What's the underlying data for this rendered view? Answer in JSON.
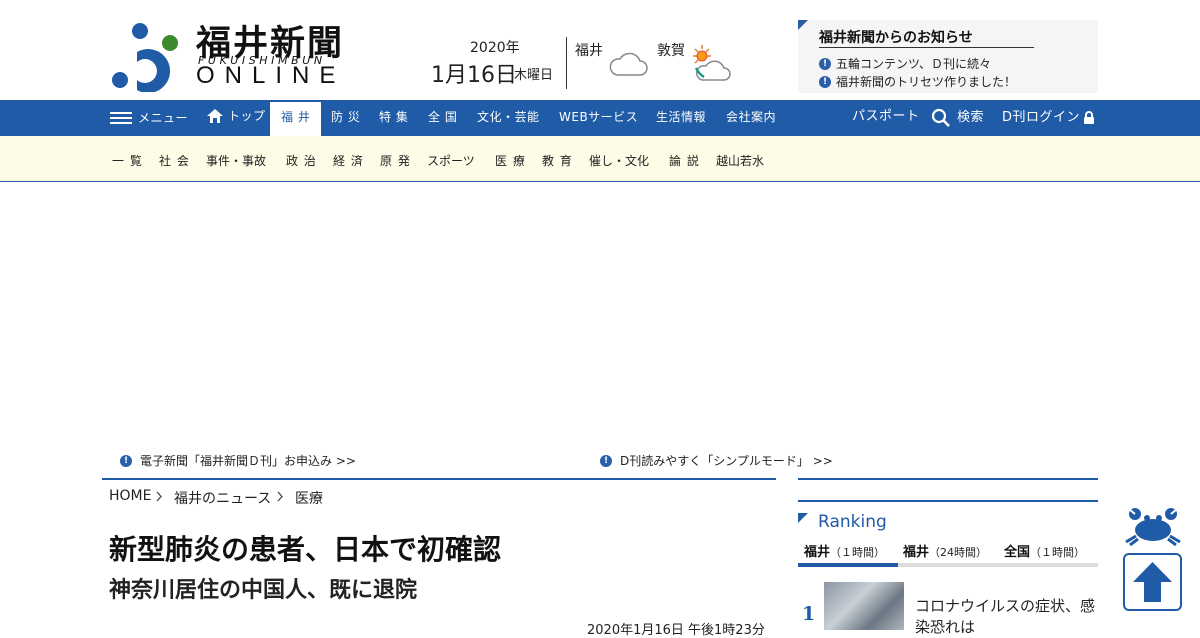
{
  "header": {
    "logo_title": "福井新聞",
    "logo_subtitle": "FUKUISHIMBUN",
    "logo_online": "ONLINE",
    "date_year": "2020年",
    "date_day": "1月16日",
    "date_weekday": "木曜日",
    "weather": [
      {
        "city": "福井",
        "icon": "cloudy-icon"
      },
      {
        "city": "敦賀",
        "icon": "sun-cloud-rain-icon"
      }
    ],
    "notice": {
      "title": "福井新聞からのお知らせ",
      "items": [
        "五輪コンテンツ、Ｄ刊に続々",
        "福井新聞のトリセツ作りました！"
      ]
    }
  },
  "nav": {
    "menu": "メニュー",
    "top": "トップ",
    "items": [
      "福 井",
      "防 災",
      "特 集",
      "全 国",
      "文化・芸能",
      "WEBサービス",
      "生活情報",
      "会社案内"
    ],
    "active": "福 井",
    "passport": "パスポート",
    "search": "検索",
    "login": "D刊ログイン"
  },
  "subnav": {
    "items": [
      "一 覧",
      "社 会",
      "事件・事故",
      "政 治",
      "経 済",
      "原 発",
      "スポーツ",
      "医 療",
      "教 育",
      "催し・文化",
      "論 説",
      "越山若水"
    ]
  },
  "promo": {
    "left": "電子新聞「福井新聞Ｄ刊」お申込み >>",
    "right": "D刊読みやすく「シンプルモード」 >>"
  },
  "breadcrumb": [
    "HOME",
    "福井のニュース",
    "医療"
  ],
  "article": {
    "headline": "新型肺炎の患者、日本で初確認",
    "subheadline": "神奈川居住の中国人、既に退院",
    "published": "2020年1月16日 午後1時23分"
  },
  "ranking": {
    "title": "Ranking",
    "tabs": [
      {
        "name": "福井",
        "period": "（１時間）"
      },
      {
        "name": "福井",
        "period": "（24時間）"
      },
      {
        "name": "全国",
        "period": "（１時間）"
      }
    ],
    "items": [
      {
        "rank": "1",
        "text": "コロナウイルスの症状、感染恐れは"
      }
    ]
  },
  "colors": {
    "brand_blue": "#1f5ba6",
    "subnav_bg": "#fdfce6"
  }
}
